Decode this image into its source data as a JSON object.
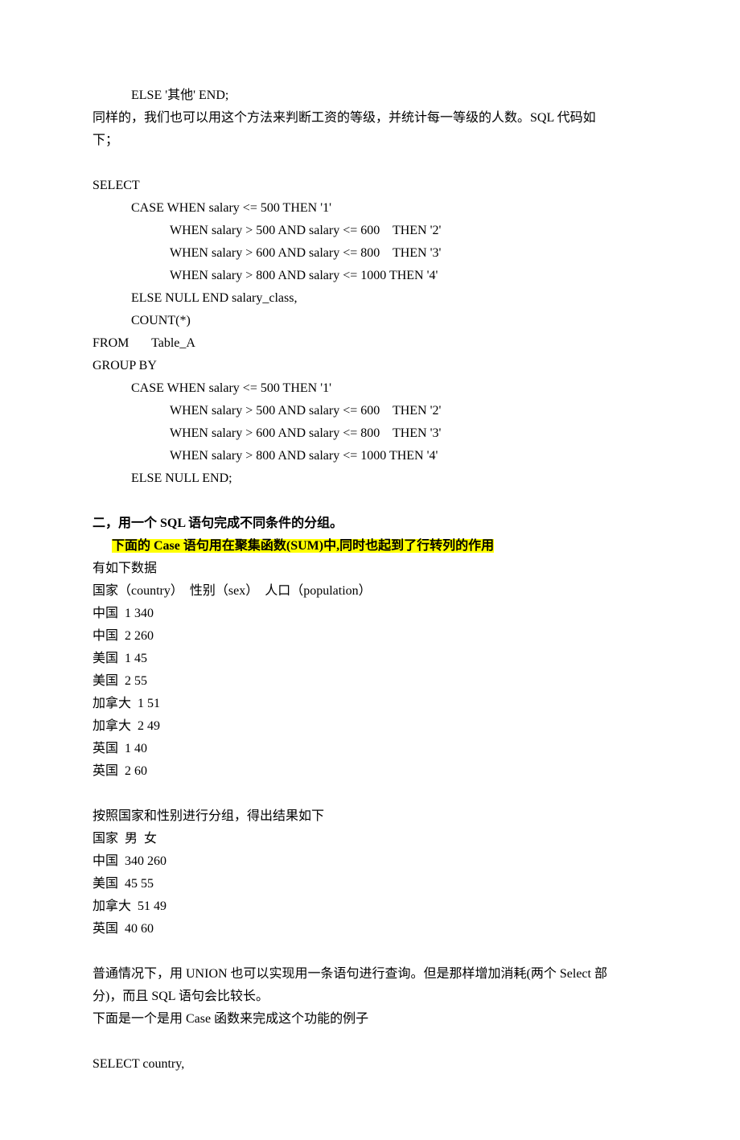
{
  "l1": "ELSE '其他' END;",
  "l2": "同样的，我们也可以用这个方法来判断工资的等级，并统计每一等级的人数。SQL 代码如",
  "l3": "下；",
  "l4": "SELECT",
  "l5": "CASE WHEN salary <= 500 THEN '1'",
  "l6": "WHEN salary > 500 AND salary <= 600    THEN '2'",
  "l7": "WHEN salary > 600 AND salary <= 800    THEN '3'",
  "l8": "WHEN salary > 800 AND salary <= 1000 THEN '4'",
  "l9": "ELSE NULL END salary_class,",
  "l10": "COUNT(*)",
  "l11": "FROM       Table_A",
  "l12": "GROUP BY",
  "l13": "CASE WHEN salary <= 500 THEN '1'",
  "l14": "WHEN salary > 500 AND salary <= 600    THEN '2'",
  "l15": "WHEN salary > 600 AND salary <= 800    THEN '3'",
  "l16": "WHEN salary > 800 AND salary <= 1000 THEN '4'",
  "l17": "ELSE NULL END;",
  "l18": "二，用一个 SQL 语句完成不同条件的分组。",
  "l19": "下面的 Case 语句用在聚集函数(SUM)中,同时也起到了行转列的作用",
  "l20": "有如下数据",
  "l21": "国家（country）  性别（sex）  人口（population）",
  "l22": "中国  1 340",
  "l23": "中国  2 260",
  "l24": "美国  1 45",
  "l25": "美国  2 55",
  "l26": "加拿大  1 51",
  "l27": "加拿大  2 49",
  "l28": "英国  1 40",
  "l29": "英国  2 60",
  "l30": "按照国家和性别进行分组，得出结果如下",
  "l31": "国家  男  女",
  "l32": "中国  340 260",
  "l33": "美国  45 55",
  "l34": "加拿大  51 49",
  "l35": "英国  40 60",
  "l36": "普通情况下，用 UNION 也可以实现用一条语句进行查询。但是那样增加消耗(两个 Select 部",
  "l37": "分)，而且 SQL 语句会比较长。",
  "l38": "下面是一个是用 Case 函数来完成这个功能的例子",
  "l39": "SELECT country,"
}
